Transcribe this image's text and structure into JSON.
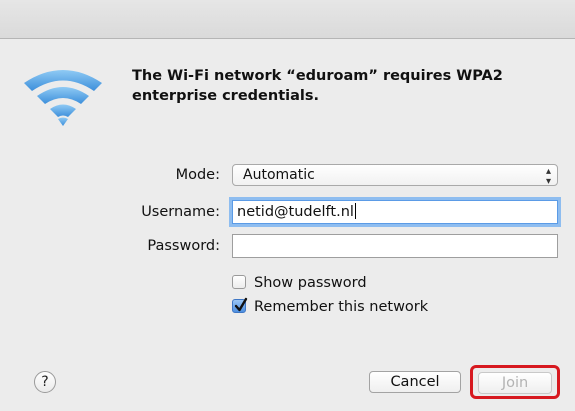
{
  "dialog": {
    "heading": "The Wi-Fi network “eduroam” requires WPA2 enterprise credentials.",
    "icon": "wifi-icon",
    "accent_color": "#5aa6e6"
  },
  "form": {
    "mode_label": "Mode:",
    "mode_value": "Automatic",
    "username_label": "Username:",
    "username_value": "netid@tudelft.nl",
    "password_label": "Password:",
    "password_value": ""
  },
  "options": {
    "show_password_label": "Show password",
    "show_password_checked": false,
    "remember_network_label": "Remember this network",
    "remember_network_checked": true
  },
  "buttons": {
    "help_label": "?",
    "cancel_label": "Cancel",
    "join_label": "Join",
    "join_enabled": false,
    "highlight_color": "#d71920"
  }
}
